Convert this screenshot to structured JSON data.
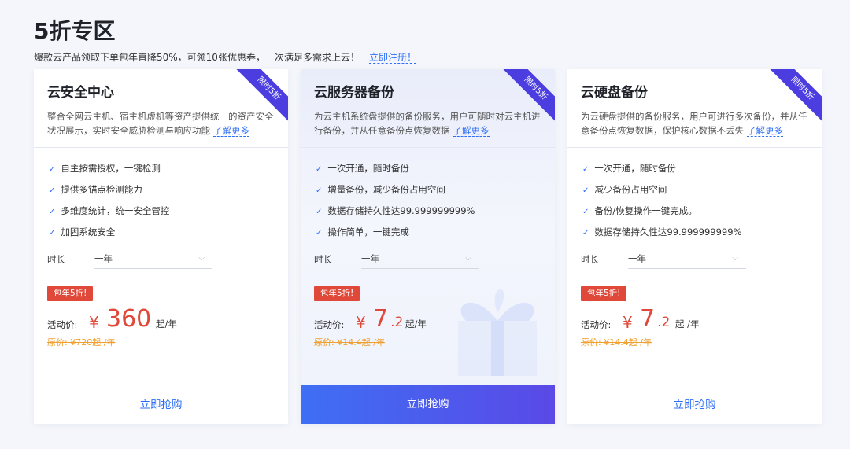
{
  "header": {
    "title": "5折专区",
    "subtitle": "爆款云产品领取下单包年直降50%，可领10张优惠券，一次满足多需求上云！",
    "register_link": "立即注册！"
  },
  "colors": {
    "accent": "#2e6ef7",
    "price": "#e0493a",
    "ribbon": "#4c3de0",
    "original_price": "#f0a030"
  },
  "cards": [
    {
      "title": "云安全中心",
      "ribbon": "限时5折",
      "desc": "整合全网云主机、宿主机虚机等资产提供统一的资产安全状况展示，实时安全威胁检测与响应功能",
      "more": "了解更多",
      "features": [
        "自主按需授权，一键检测",
        "提供多锚点检测能力",
        "多维度统计，统一安全管控",
        "加固系统安全"
      ],
      "duration_label": "时长",
      "duration_value": "一年",
      "badge": "包年5折!",
      "price_label": "活动价:",
      "currency": "¥",
      "price_int": "360",
      "price_dec": "",
      "unit": "起/年",
      "original": "原价: ¥720起 /年",
      "buy": "立即抢购",
      "featured": false
    },
    {
      "title": "云服务器备份",
      "ribbon": "限时5折",
      "desc": "为云主机系统盘提供的备份服务，用户可随时对云主机进行备份，并从任意备份点恢复数据",
      "more": "了解更多",
      "features": [
        "一次开通，随时备份",
        "增量备份，减少备份占用空间",
        "数据存储持久性达99.999999999%",
        "操作简单，一键完成"
      ],
      "duration_label": "时长",
      "duration_value": "一年",
      "badge": "包年5折!",
      "price_label": "活动价:",
      "currency": "¥",
      "price_int": "7",
      "price_dec": ".2",
      "unit": "起/年",
      "original": "原价: ¥14.4起 /年",
      "buy": "立即抢购",
      "featured": true
    },
    {
      "title": "云硬盘备份",
      "ribbon": "限时5折",
      "desc": "为云硬盘提供的备份服务，用户可进行多次备份，并从任意备份点恢复数据，保护核心数据不丢失",
      "more": "了解更多",
      "features": [
        "一次开通，随时备份",
        "减少备份占用空间",
        "备份/恢复操作一键完成。",
        "数据存储持久性达99.999999999%"
      ],
      "duration_label": "时长",
      "duration_value": "一年",
      "badge": "包年5折!",
      "price_label": "活动价:",
      "currency": "¥",
      "price_int": "7",
      "price_dec": ".2",
      "unit": "起 /年",
      "original": "原价: ¥14.4起 /年",
      "buy": "立即抢购",
      "featured": false
    }
  ]
}
